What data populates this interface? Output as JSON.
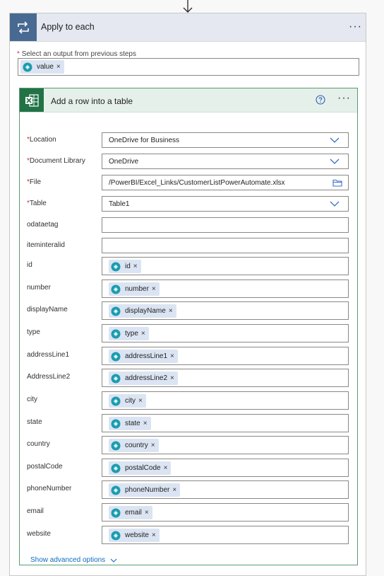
{
  "apply_to_each": {
    "title": "Apply to each",
    "more_label": "···",
    "select_label": "Select an output from previous steps",
    "required_mark": "*",
    "token": {
      "label": "value",
      "close": "×"
    }
  },
  "excel_action": {
    "title": "Add a row into a table",
    "more_label": "···",
    "fields": {
      "location": {
        "label": "Location",
        "value": "OneDrive for Business"
      },
      "document_library": {
        "label": "Document Library",
        "value": "OneDrive"
      },
      "file": {
        "label": "File",
        "value": "/PowerBI/Excel_Links/CustomerListPowerAutomate.xlsx"
      },
      "table": {
        "label": "Table",
        "value": "Table1"
      },
      "odataetag": {
        "label": "odataetag",
        "value": ""
      },
      "iteminteralid": {
        "label": "iteminteralid",
        "value": ""
      },
      "id": {
        "label": "id",
        "token": "id"
      },
      "number": {
        "label": "number",
        "token": "number"
      },
      "displayName": {
        "label": "displayName",
        "token": "displayName"
      },
      "type": {
        "label": "type",
        "token": "type"
      },
      "addressLine1": {
        "label": "addressLine1",
        "token": "addressLine1"
      },
      "addressLine2": {
        "label": "AddressLine2",
        "token": "addressLine2"
      },
      "city": {
        "label": "city",
        "token": "city"
      },
      "state": {
        "label": "state",
        "token": "state"
      },
      "country": {
        "label": "country",
        "token": "country"
      },
      "postalCode": {
        "label": "postalCode",
        "token": "postalCode"
      },
      "phoneNumber": {
        "label": "phoneNumber",
        "token": "phoneNumber"
      },
      "email": {
        "label": "email",
        "token": "email"
      },
      "website": {
        "label": "website",
        "token": "website"
      }
    },
    "token_close": "×",
    "show_advanced": "Show advanced options"
  },
  "colors": {
    "loop_accent": "#486991",
    "excel_green": "#217346",
    "link_blue": "#0f6cbd",
    "token_bg": "#dbe4f2",
    "required_red": "#c4314b"
  }
}
